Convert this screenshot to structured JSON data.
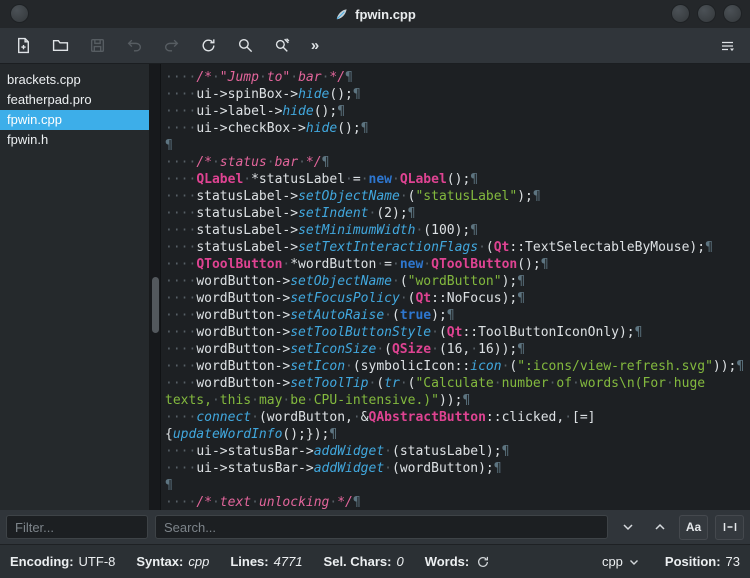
{
  "window": {
    "title": "fpwin.cpp"
  },
  "colors": {
    "selection": "#3daee9",
    "editor_bg": "#1d2023",
    "panel_bg": "#30353a"
  },
  "toolbar": {
    "overflow_label": "»",
    "icons": [
      "new-document-icon",
      "open-folder-icon",
      "save-icon",
      "undo-icon",
      "redo-icon",
      "reload-icon",
      "search-icon",
      "search-replace-icon",
      "double-chevron-icon",
      "menu-icon"
    ]
  },
  "sidebar": {
    "items": [
      {
        "label": "brackets.cpp",
        "selected": false
      },
      {
        "label": "featherpad.pro",
        "selected": false
      },
      {
        "label": "fpwin.cpp",
        "selected": true
      },
      {
        "label": "fpwin.h",
        "selected": false
      }
    ]
  },
  "editor": {
    "lines": [
      [
        [
          "pln",
          "····"
        ],
        [
          "cmt",
          "/*·\"Jump·to\"·bar·*/"
        ],
        [
          "pil",
          "¶"
        ]
      ],
      [
        [
          "pln",
          "····ui->spinBox->"
        ],
        [
          "fn",
          "hide"
        ],
        [
          "pln",
          "();"
        ],
        [
          "pil",
          "¶"
        ]
      ],
      [
        [
          "pln",
          "····ui->label->"
        ],
        [
          "fn",
          "hide"
        ],
        [
          "pln",
          "();"
        ],
        [
          "pil",
          "¶"
        ]
      ],
      [
        [
          "pln",
          "····ui->checkBox->"
        ],
        [
          "fn",
          "hide"
        ],
        [
          "pln",
          "();"
        ],
        [
          "pil",
          "¶"
        ]
      ],
      [
        [
          "pil",
          "¶"
        ]
      ],
      [
        [
          "pln",
          "····"
        ],
        [
          "cmt",
          "/*·status·bar·*/"
        ],
        [
          "pil",
          "¶"
        ]
      ],
      [
        [
          "pln",
          "····"
        ],
        [
          "typ",
          "QLabel"
        ],
        [
          "pln",
          "·*statusLabel·=·"
        ],
        [
          "kw",
          "new"
        ],
        [
          "pln",
          "·"
        ],
        [
          "typ",
          "QLabel"
        ],
        [
          "pln",
          "();"
        ],
        [
          "pil",
          "¶"
        ]
      ],
      [
        [
          "pln",
          "····statusLabel->"
        ],
        [
          "fn",
          "setObjectName"
        ],
        [
          "pln",
          "·("
        ],
        [
          "str",
          "\"statusLabel\""
        ],
        [
          "pln",
          ");"
        ],
        [
          "pil",
          "¶"
        ]
      ],
      [
        [
          "pln",
          "····statusLabel->"
        ],
        [
          "fn",
          "setIndent"
        ],
        [
          "pln",
          "·(2);"
        ],
        [
          "pil",
          "¶"
        ]
      ],
      [
        [
          "pln",
          "····statusLabel->"
        ],
        [
          "fn",
          "setMinimumWidth"
        ],
        [
          "pln",
          "·(100);"
        ],
        [
          "pil",
          "¶"
        ]
      ],
      [
        [
          "pln",
          "····statusLabel->"
        ],
        [
          "fn",
          "setTextInteractionFlags"
        ],
        [
          "pln",
          "·("
        ],
        [
          "typ",
          "Qt"
        ],
        [
          "pln",
          "::TextSelectableByMouse);"
        ],
        [
          "pil",
          "¶"
        ]
      ],
      [
        [
          "pln",
          "····"
        ],
        [
          "typ",
          "QToolButton"
        ],
        [
          "pln",
          "·*wordButton·=·"
        ],
        [
          "kw",
          "new"
        ],
        [
          "pln",
          "·"
        ],
        [
          "typ",
          "QToolButton"
        ],
        [
          "pln",
          "();"
        ],
        [
          "pil",
          "¶"
        ]
      ],
      [
        [
          "pln",
          "····wordButton->"
        ],
        [
          "fn",
          "setObjectName"
        ],
        [
          "pln",
          "·("
        ],
        [
          "str",
          "\"wordButton\""
        ],
        [
          "pln",
          ");"
        ],
        [
          "pil",
          "¶"
        ]
      ],
      [
        [
          "pln",
          "····wordButton->"
        ],
        [
          "fn",
          "setFocusPolicy"
        ],
        [
          "pln",
          "·("
        ],
        [
          "typ",
          "Qt"
        ],
        [
          "pln",
          "::NoFocus);"
        ],
        [
          "pil",
          "¶"
        ]
      ],
      [
        [
          "pln",
          "····wordButton->"
        ],
        [
          "fn",
          "setAutoRaise"
        ],
        [
          "pln",
          "·("
        ],
        [
          "kw",
          "true"
        ],
        [
          "pln",
          ");"
        ],
        [
          "pil",
          "¶"
        ]
      ],
      [
        [
          "pln",
          "····wordButton->"
        ],
        [
          "fn",
          "setToolButtonStyle"
        ],
        [
          "pln",
          "·("
        ],
        [
          "typ",
          "Qt"
        ],
        [
          "pln",
          "::ToolButtonIconOnly);"
        ],
        [
          "pil",
          "¶"
        ]
      ],
      [
        [
          "pln",
          "····wordButton->"
        ],
        [
          "fn",
          "setIconSize"
        ],
        [
          "pln",
          "·("
        ],
        [
          "typ",
          "QSize"
        ],
        [
          "pln",
          "·(16,·16));"
        ],
        [
          "pil",
          "¶"
        ]
      ],
      [
        [
          "pln",
          "····wordButton->"
        ],
        [
          "fn",
          "setIcon"
        ],
        [
          "pln",
          "·(symbolicIcon::"
        ],
        [
          "fn",
          "icon"
        ],
        [
          "pln",
          "·("
        ],
        [
          "str",
          "\":icons/view-refresh.svg\""
        ],
        [
          "pln",
          "));"
        ],
        [
          "pil",
          "¶"
        ]
      ],
      [
        [
          "pln",
          "····wordButton->"
        ],
        [
          "fn",
          "setToolTip"
        ],
        [
          "pln",
          "·("
        ],
        [
          "fn",
          "tr"
        ],
        [
          "pln",
          "·("
        ],
        [
          "str",
          "\"Calculate·number·of·words\\n(For·huge"
        ]
      ],
      [
        [
          "str",
          "texts,·this·may·be·CPU-intensive.)\""
        ],
        [
          "pln",
          "));"
        ],
        [
          "pil",
          "¶"
        ]
      ],
      [
        [
          "pln",
          "····"
        ],
        [
          "fn",
          "connect"
        ],
        [
          "pln",
          "·(wordButton,·&"
        ],
        [
          "typ",
          "QAbstractButton"
        ],
        [
          "pln",
          "::clicked,·[=]"
        ]
      ],
      [
        [
          "pln",
          "{"
        ],
        [
          "fn",
          "updateWordInfo"
        ],
        [
          "pln",
          "();});"
        ],
        [
          "pil",
          "¶"
        ]
      ],
      [
        [
          "pln",
          "····ui->statusBar->"
        ],
        [
          "fn",
          "addWidget"
        ],
        [
          "pln",
          "·(statusLabel);"
        ],
        [
          "pil",
          "¶"
        ]
      ],
      [
        [
          "pln",
          "····ui->statusBar->"
        ],
        [
          "fn",
          "addWidget"
        ],
        [
          "pln",
          "·(wordButton);"
        ],
        [
          "pil",
          "¶"
        ]
      ],
      [
        [
          "pil",
          "¶"
        ]
      ],
      [
        [
          "pln",
          "····"
        ],
        [
          "cmt",
          "/*·text·unlocking·*/"
        ],
        [
          "pil",
          "¶"
        ]
      ]
    ]
  },
  "findbar": {
    "filter_placeholder": "Filter...",
    "search_placeholder": "Search...",
    "match_case_label": "Aa"
  },
  "statusbar": {
    "encoding_label": "Encoding:",
    "encoding_value": "UTF-8",
    "syntax_label": "Syntax:",
    "syntax_value": "cpp",
    "lines_label": "Lines:",
    "lines_value": "4771",
    "sel_chars_label": "Sel. Chars:",
    "sel_chars_value": "0",
    "words_label": "Words:",
    "lang_selector_value": "cpp",
    "position_label": "Position:",
    "position_value": "73"
  }
}
